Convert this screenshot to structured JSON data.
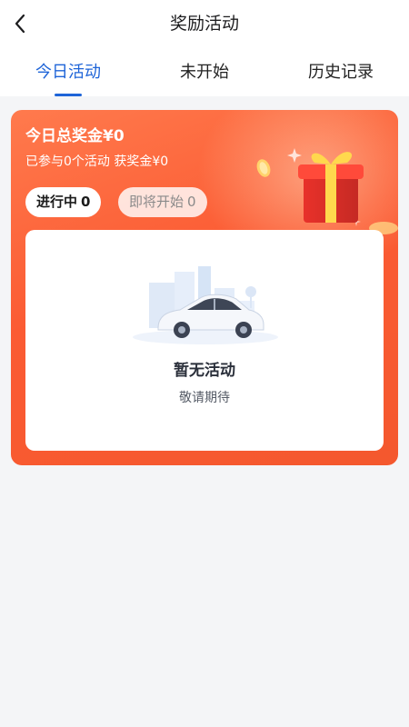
{
  "header": {
    "title": "奖励活动",
    "back_icon": "chevron-left-icon"
  },
  "tabs": [
    {
      "label": "今日活动",
      "active": true
    },
    {
      "label": "未开始",
      "active": false
    },
    {
      "label": "历史记录",
      "active": false
    }
  ],
  "colors": {
    "accent": "#1e64d8",
    "card_orange": "#fb5b33",
    "background": "#f4f5f7"
  },
  "summary": {
    "total_label": "今日总奖金¥0",
    "detail": "已参与0个活动 获奖金¥0",
    "filters": [
      {
        "label": "进行中",
        "count": "0",
        "selected": true
      },
      {
        "label": "即将开始",
        "count": "0",
        "selected": false
      }
    ],
    "decor_icon": "gift-box-icon"
  },
  "empty_state": {
    "illustration": "car-city-illustration",
    "title": "暂无活动",
    "subtitle": "敬请期待"
  }
}
